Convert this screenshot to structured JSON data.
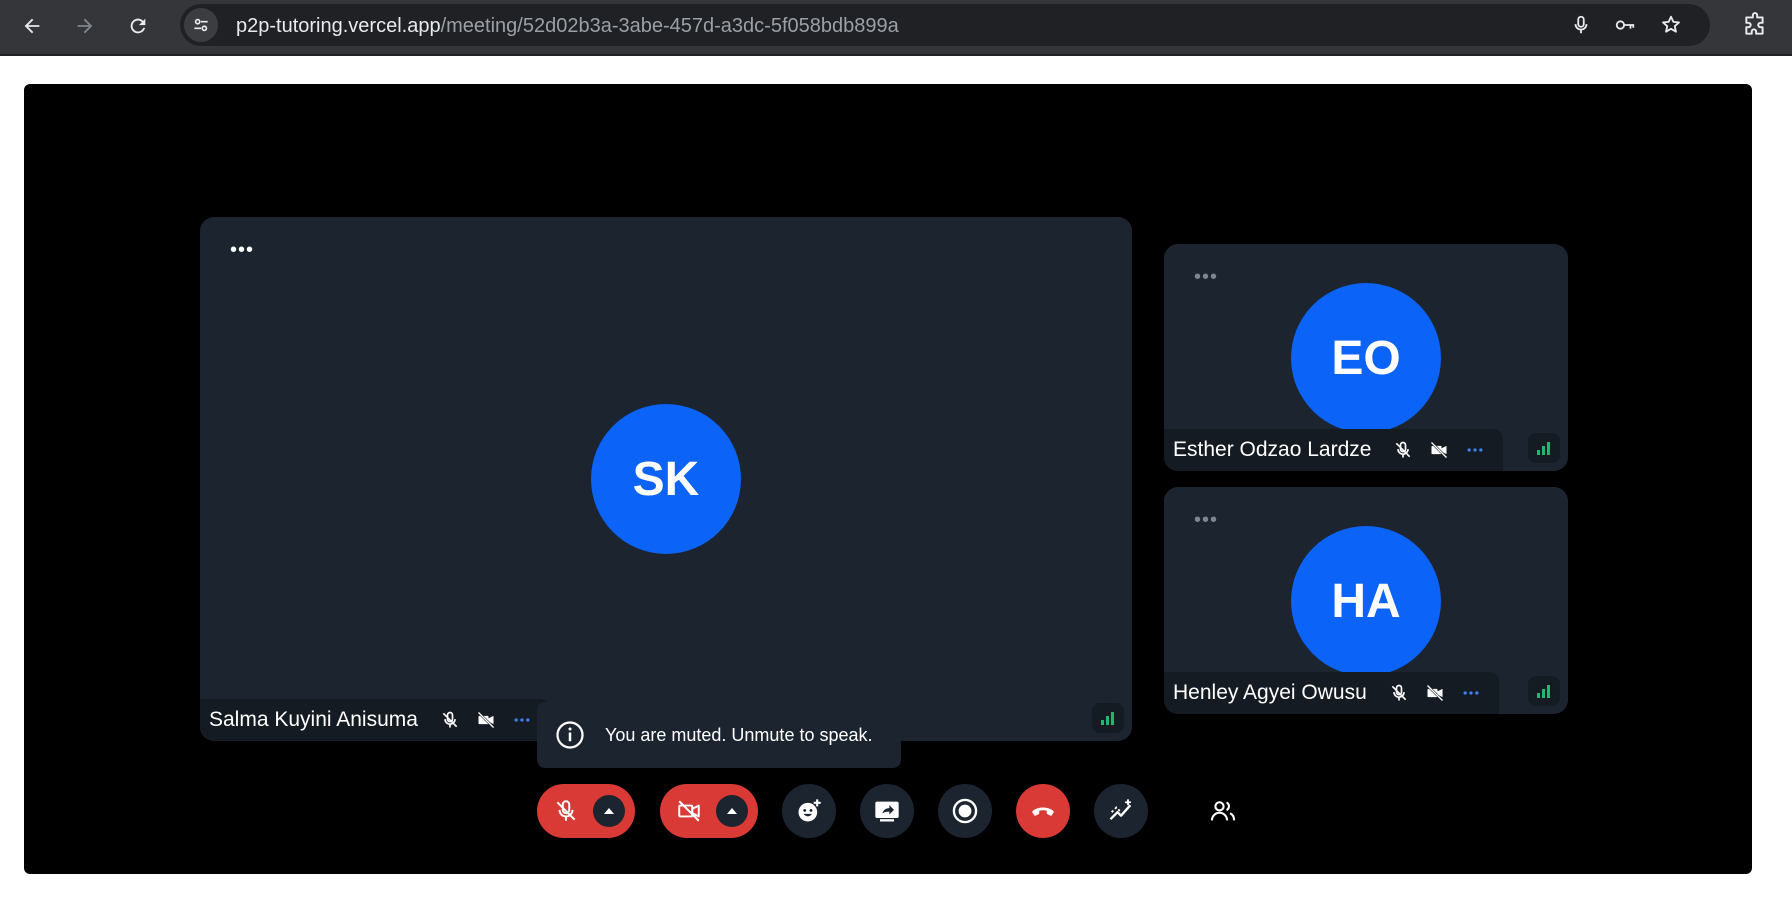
{
  "browser": {
    "url_host": "p2p-tutoring.vercel.app",
    "url_path": "/meeting/52d02b3a-3abe-457d-a3dc-5f058bdb899a"
  },
  "participants": [
    {
      "initials": "SK",
      "name": "Salma Kuyini Anisuma",
      "mic_muted": true,
      "camera_off": true
    },
    {
      "initials": "EO",
      "name": "Esther Odzao Lardze",
      "mic_muted": true,
      "camera_off": true
    },
    {
      "initials": "HA",
      "name": "Henley Agyei Owusu",
      "mic_muted": true,
      "camera_off": true
    }
  ],
  "tile_menu_glyph": "•••",
  "toast": {
    "text": "You are muted. Unmute to speak."
  },
  "colors": {
    "avatar": "#0b63f7",
    "tile_bg": "#1c2430",
    "danger": "#d93a35",
    "signal": "#1fb871",
    "more_dots": "#3b82f6"
  },
  "controls": [
    {
      "name": "microphone-toggle",
      "icon": "mic-off-icon",
      "state": "muted"
    },
    {
      "name": "camera-toggle",
      "icon": "camera-off-icon",
      "state": "off"
    },
    {
      "name": "reactions",
      "icon": "emoji-add-icon"
    },
    {
      "name": "screen-share",
      "icon": "screen-share-icon"
    },
    {
      "name": "record",
      "icon": "record-icon"
    },
    {
      "name": "leave-call",
      "icon": "hang-up-icon"
    },
    {
      "name": "stats",
      "icon": "stats-icon"
    },
    {
      "name": "participants",
      "icon": "people-icon"
    }
  ]
}
